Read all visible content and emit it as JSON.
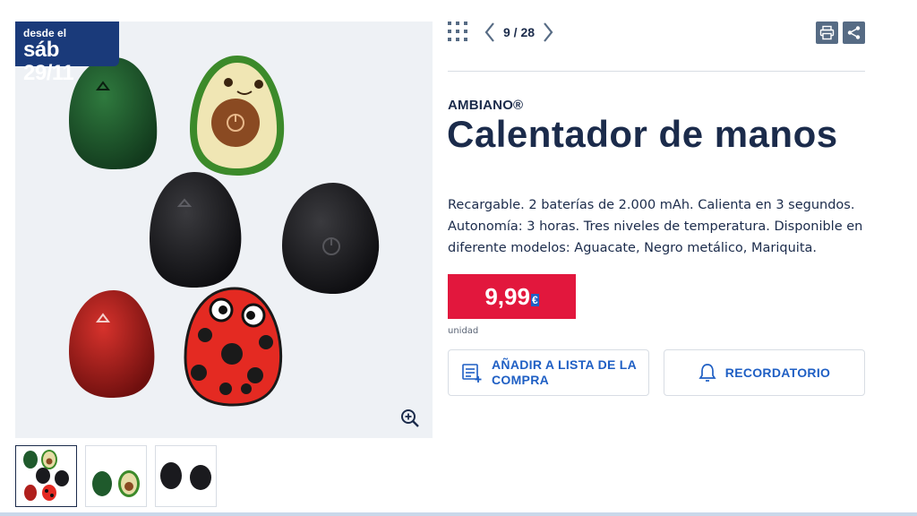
{
  "gallery": {
    "badge": {
      "line1": "desde el",
      "line2": "sáb 29/11"
    },
    "zoom_icon": "magnifier-plus-icon"
  },
  "nav": {
    "pager_text": "9 / 28",
    "grid_icon": "grid-icon",
    "prev_icon": "chevron-left-icon",
    "next_icon": "chevron-right-icon",
    "print_icon": "print-icon",
    "share_icon": "share-icon"
  },
  "product": {
    "brand": "AMBIANO®",
    "title": "Calentador de manos",
    "description": "Recargable. 2 baterías de 2.000 mAh. Calienta en 3 segundos. Autonomía: 3 horas. Tres niveles de temperatura. Disponible en diferente modelos: Aguacate, Negro metálico, Mariquita.",
    "price": "9,99",
    "currency": "€",
    "unit": "unidad"
  },
  "actions": {
    "add_list_label": "AÑADIR A LISTA DE LA COMPRA",
    "reminder_label": "RECORDATORIO"
  },
  "colors": {
    "primary_navy": "#1b2b4b",
    "price_red": "#e2173d",
    "link_blue": "#1f5fc4",
    "badge_navy": "#1a3a7a"
  }
}
